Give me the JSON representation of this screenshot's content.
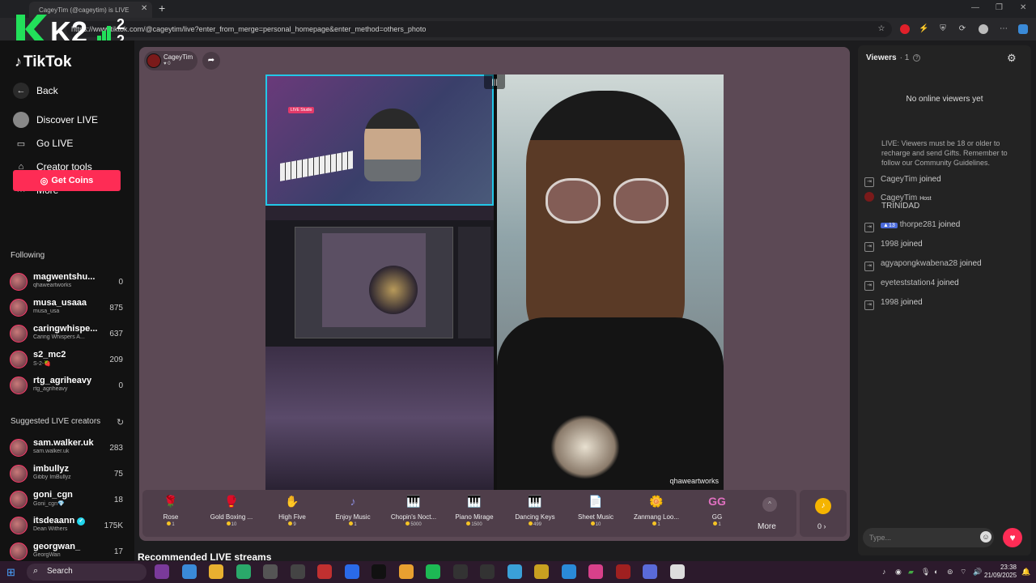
{
  "browser": {
    "tab_title": "CageyTim (@cageytim) is LIVE",
    "url": "https://www.tiktok.com/@cageytim/live?enter_from_merge=personal_homepage&enter_method=others_photo"
  },
  "overlay_logo": {
    "left": "K2",
    "right_top": "2",
    "right_bottom": "2"
  },
  "sidebar": {
    "logo": "TikTok",
    "nav": [
      {
        "label": "Back",
        "icon": "back-arrow-icon"
      },
      {
        "label": "Discover LIVE",
        "icon": "discover-live-icon"
      },
      {
        "label": "Go LIVE",
        "icon": "camera-icon"
      },
      {
        "label": "Creator tools",
        "icon": "creator-tools-icon"
      },
      {
        "label": "More",
        "icon": "more-dots-icon"
      }
    ],
    "get_coins": "Get Coins",
    "following_header": "Following",
    "following": [
      {
        "name": "magwentshu...",
        "sub": "qhaweartworks",
        "count": "0"
      },
      {
        "name": "musa_usaaa",
        "sub": "musa_usa",
        "count": "875"
      },
      {
        "name": "caringwhispe...",
        "sub": "Caring Whispers A...",
        "count": "637"
      },
      {
        "name": "s2_mc2",
        "sub": "S-2-🍓",
        "count": "209"
      },
      {
        "name": "rtg_agriheavy",
        "sub": "rtg_agriheavy",
        "count": "0"
      }
    ],
    "suggested_header": "Suggested LIVE creators",
    "suggested": [
      {
        "name": "sam.walker.uk",
        "sub": "sam.walker.uk",
        "count": "283"
      },
      {
        "name": "imbullyz",
        "sub": "Gibby ImBullyz",
        "count": "75"
      },
      {
        "name": "goni_cgn",
        "sub": "Goni_cgn💎",
        "count": "18"
      },
      {
        "name": "itsdeaann",
        "sub": "Dean Withers",
        "count": "175K"
      },
      {
        "name": "georgwan_",
        "sub": "GeorgWan",
        "count": "17"
      }
    ]
  },
  "stream": {
    "host_name": "CageyTim",
    "host_likes": "0",
    "watermark": "qhaweartworks",
    "cam_badge": "LIVE Studio",
    "recommended_title": "Recommended LIVE streams"
  },
  "gifts": [
    {
      "name": "Rose",
      "price": "1",
      "icon": "🌹",
      "color": "#e23a4a"
    },
    {
      "name": "Gold Boxing ...",
      "price": "10",
      "icon": "🥊",
      "color": "#f0c040"
    },
    {
      "name": "High Five",
      "price": "9",
      "icon": "✋",
      "color": "#f0b090"
    },
    {
      "name": "Enjoy Music",
      "price": "1",
      "icon": "♪",
      "color": "#8a8ad8"
    },
    {
      "name": "Chopin's Noct...",
      "price": "5000",
      "icon": "🎹",
      "color": "#6ab0e0"
    },
    {
      "name": "Piano Mirage",
      "price": "1500",
      "icon": "🎹",
      "color": "#8a6a5a"
    },
    {
      "name": "Dancing Keys",
      "price": "499",
      "icon": "🎹",
      "color": "#cccccc"
    },
    {
      "name": "Sheet Music",
      "price": "10",
      "icon": "📄",
      "color": "#eeeeee"
    },
    {
      "name": "Zanmang Loo...",
      "price": "1",
      "icon": "🌼",
      "color": "#e8a0c0"
    },
    {
      "name": "GG",
      "price": "1",
      "icon": "GG",
      "color": "#e070c0"
    }
  ],
  "gift_more": "More",
  "coin_balance": "0 ›",
  "chat": {
    "viewers_label": "Viewers",
    "viewers_count": "· 1",
    "no_viewers": "No online viewers yet",
    "notice": "LIVE: Viewers must be 18 or older to recharge and send Gifts. Remember to follow our Community Guidelines.",
    "events": [
      {
        "name": "CageyTim",
        "text": "joined"
      },
      {
        "name": "CageyTim",
        "tag": "Host",
        "text": "TRINIDAD"
      },
      {
        "name": "thorpe281",
        "level": "13",
        "text": "joined"
      },
      {
        "name": "1998",
        "text": "joined"
      },
      {
        "name": "agyapongkwabena28",
        "text": "joined"
      },
      {
        "name": "eyeteststation4",
        "text": "joined"
      },
      {
        "name": "1998",
        "text": "joined"
      }
    ],
    "placeholder": "Type..."
  },
  "taskbar": {
    "search": "Search",
    "time": "23:38",
    "date": "21/09/2025"
  },
  "colors": {
    "accent": "#fe2c55",
    "stage": "#5c4955",
    "cyan": "#22c7e8"
  }
}
